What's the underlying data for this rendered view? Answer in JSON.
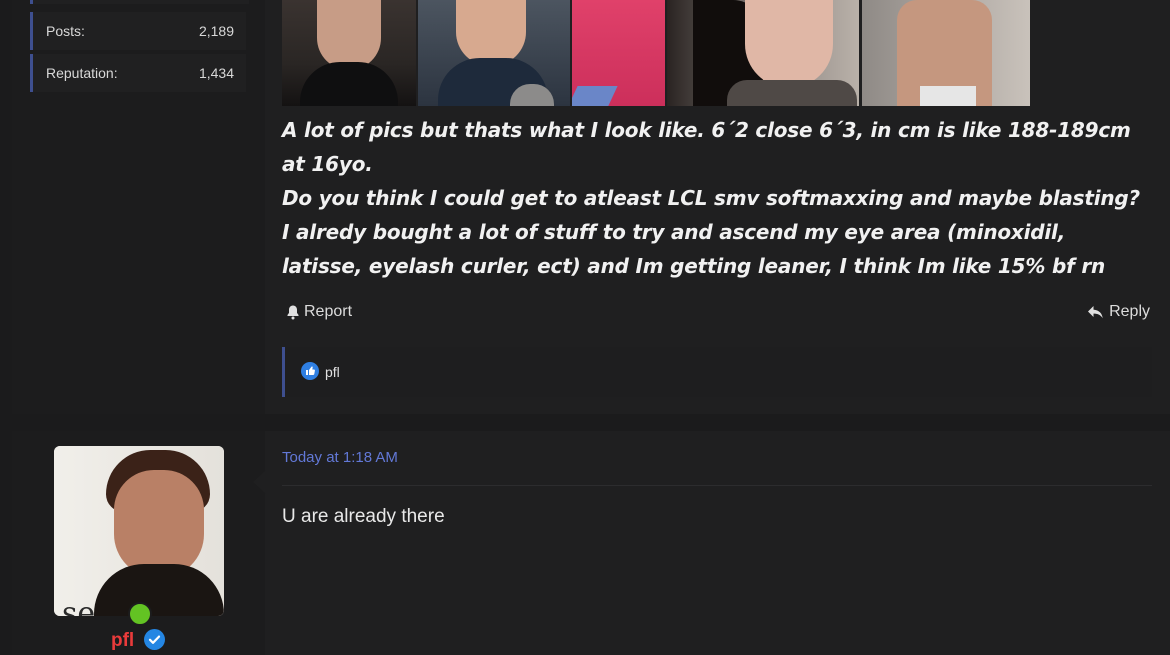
{
  "post1": {
    "user_stats": [
      {
        "label": "Posts:",
        "value": "2,189"
      },
      {
        "label": "Reputation:",
        "value": "1,434"
      }
    ],
    "message_lines": [
      "A lot of pics but thats what I look like. 6´2 close 6´3, in cm is like 188-189cm",
      "at 16yo.",
      "Do you think I could get to atleast LCL smv softmaxxing and maybe blasting?",
      "I alredy bought a lot of stuff to try and ascend my eye area (minoxidil,",
      "latisse, eyelash curler, ect) and Im getting leaner, I think Im like 15% bf rn"
    ],
    "actions": {
      "report_label": "Report",
      "reply_label": "Reply"
    },
    "reaction_user": "pfl"
  },
  "post2": {
    "username": "pfl",
    "timestamp": "Today at 1:18 AM",
    "text": "U are already there"
  },
  "colors": {
    "accent": "#3e4f8f",
    "timestamp": "#6278d6",
    "username": "#e93b3b",
    "online": "#63c323",
    "verified": "#2486e3"
  },
  "icons": [
    "bell-icon",
    "reply-arrow-icon",
    "like-reaction-icon",
    "verified-badge-icon",
    "online-status-icon"
  ]
}
